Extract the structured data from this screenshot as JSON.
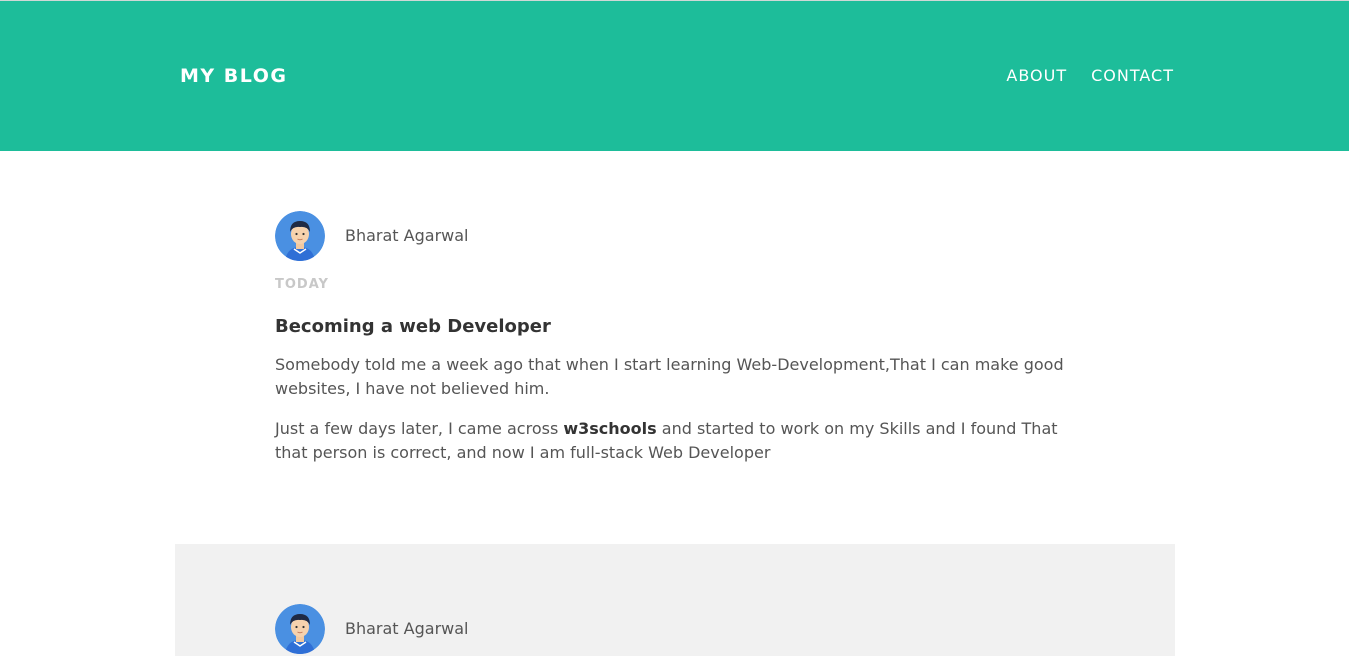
{
  "header": {
    "brand": "MY BLOG",
    "nav": [
      {
        "label": "ABOUT"
      },
      {
        "label": "CONTACT"
      }
    ]
  },
  "colors": {
    "header_bg": "#1dbd9a",
    "band_bg": "#f1f1f1",
    "avatar_bg": "#4a90e2"
  },
  "posts": [
    {
      "author": "Bharat Agarwal",
      "avatar_icon": "user-avatar-icon",
      "date": "TODAY",
      "title": "Becoming a web Developer",
      "paragraph1": "Somebody told me a week ago that when I start learning Web-Development,That I can make good websites, I have not believed him.",
      "paragraph2_before": "Just a few days later, I came across ",
      "paragraph2_bold": "w3schools",
      "paragraph2_after": " and started to work on my Skills and I found That that person is correct, and now I am full-stack Web Developer"
    },
    {
      "author": "Bharat Agarwal",
      "avatar_icon": "user-avatar-icon"
    }
  ]
}
